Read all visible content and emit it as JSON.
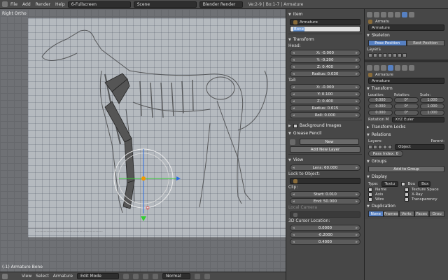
{
  "topbar": {
    "menu": [
      "File",
      "Add",
      "Render",
      "Help"
    ],
    "layout": "6-Fullscreen",
    "scene": "Scene",
    "engine": "Blender Render",
    "stats": "Ve:2-9 | Bo:1-7 | Armature"
  },
  "viewport": {
    "view_label": "Right Ortho",
    "object_label": "(-1) Armature Bone"
  },
  "header3d": {
    "menus": [
      "View",
      "Select",
      "Armature"
    ],
    "mode": "Edit Mode",
    "pivot": "Normal"
  },
  "npanel": {
    "item_title": "Item",
    "object_name": "Armature",
    "bone_name": "Bone",
    "transform_title": "Transform",
    "head_label": "Head:",
    "head": {
      "x": "X: -0.000",
      "y": "Y: -0.200",
      "z": "Z: 0.400",
      "radius": "Radius: 0.030"
    },
    "tail_label": "Tail:",
    "tail": {
      "x": "X: -0.000",
      "y": "Y: 0.100",
      "z": "Z: 0.400",
      "radius": "Radius: 0.015",
      "roll": "Roll: 0.000"
    },
    "bg_images": "Background Images",
    "grease_pencil": "Grease Pencil",
    "new_btn": "New",
    "add_layer": "Add New Layer",
    "view_title": "View",
    "lens": "Lens: 60.000",
    "lock_label": "Lock to Object:",
    "clip_label": "Clip:",
    "clip_start": "Start: 0.010",
    "clip_end": "End: 50.000",
    "local_camera": "Local Camera",
    "cursor_label": "3D Cursor Location:",
    "cursor": [
      "0.0000",
      "-0.2000",
      "0.4000"
    ]
  },
  "props_top": {
    "breadcrumb": "Armatu",
    "name": "Armature",
    "skeleton": "Skeleton",
    "pose_position": "Pose Position",
    "rest_position": "Rest Position",
    "layers_label": "Layers"
  },
  "props": {
    "breadcrumb": "Armature",
    "object_name": "Armature",
    "transform": "Transform",
    "location": "Location:",
    "rotation": "Rotation:",
    "scale": "Scale:",
    "loc": [
      "0.000",
      "0.000",
      "0.000"
    ],
    "rot": [
      "0°",
      "0°",
      "0°"
    ],
    "scl": [
      "1.000",
      "1.000",
      "1.000"
    ],
    "rotation_mode_label": "Rotation M",
    "rotation_mode": "XYZ Euler",
    "transform_locks": "Transform Locks",
    "relations": "Relations",
    "layers": "Layers:",
    "parent": "Parent:",
    "object_field": "Object",
    "pass_index": "Pass Index: 0",
    "groups": "Groups",
    "add_to_group": "Add to Group",
    "display": "Display",
    "type_label": "Type:",
    "type_value": "Textu",
    "bounds": "Bou",
    "box": "Box",
    "name_chk": "Name",
    "texture_space": "Texture Space",
    "axis_chk": "Axis",
    "xray": "X-Ray",
    "wire": "Wire",
    "transparency": "Transparency",
    "duplication": "Duplication",
    "dup_tabs": [
      "None",
      "Frames",
      "Verts",
      "Faces",
      "Grou"
    ]
  }
}
